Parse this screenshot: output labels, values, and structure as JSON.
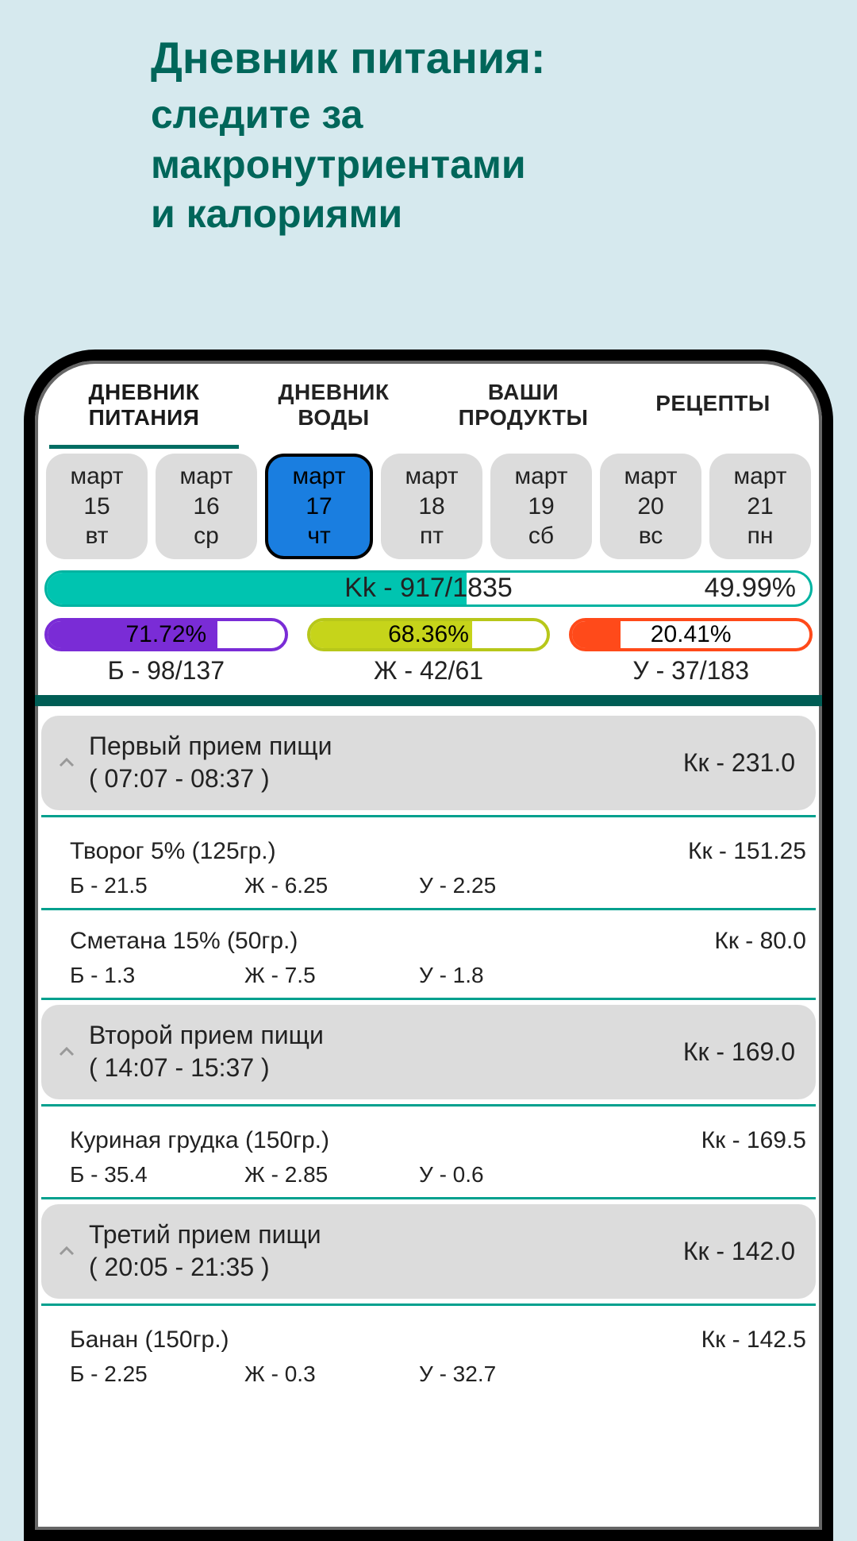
{
  "promo": {
    "title": "Дневник питания:",
    "subtitle": "следите за\nмакронутриентами\nи калориями"
  },
  "tabs": [
    {
      "label": "ДНЕВНИК\nПИТАНИЯ",
      "active": true
    },
    {
      "label": "ДНЕВНИК\nВОДЫ",
      "active": false
    },
    {
      "label": "ВАШИ\nПРОДУКТЫ",
      "active": false
    },
    {
      "label": "РЕЦЕПТЫ",
      "active": false
    }
  ],
  "dates": [
    {
      "month": "март",
      "day": "15",
      "weekday": "вт"
    },
    {
      "month": "март",
      "day": "16",
      "weekday": "ср"
    },
    {
      "month": "март",
      "day": "17",
      "weekday": "чт",
      "selected": true
    },
    {
      "month": "март",
      "day": "18",
      "weekday": "пт"
    },
    {
      "month": "март",
      "day": "19",
      "weekday": "сб"
    },
    {
      "month": "март",
      "day": "20",
      "weekday": "вс"
    },
    {
      "month": "март",
      "day": "21",
      "weekday": "пн"
    }
  ],
  "kk": {
    "center": "Kk - 917/1835",
    "percent": "49.99%",
    "fillPct": 55
  },
  "macros": {
    "b": {
      "pct": "71.72%",
      "fill": 71.72,
      "label": "Б - 98/137"
    },
    "f": {
      "pct": "68.36%",
      "fill": 68.36,
      "label": "Ж - 42/61"
    },
    "u": {
      "pct": "20.41%",
      "fill": 20.41,
      "label": "У - 37/183"
    }
  },
  "meals": [
    {
      "title": "Первый прием пищи",
      "time": "( 07:07 - 08:37 )",
      "kk": "Кк - 231.0",
      "items": [
        {
          "name": "Творог 5% (125гр.)",
          "kk": "Кк - 151.25",
          "b": "Б - 21.5",
          "f": "Ж - 6.25",
          "u": "У - 2.25"
        },
        {
          "name": "Сметана 15% (50гр.)",
          "kk": "Кк - 80.0",
          "b": "Б - 1.3",
          "f": "Ж - 7.5",
          "u": "У - 1.8"
        }
      ]
    },
    {
      "title": "Второй прием пищи",
      "time": "( 14:07 - 15:37 )",
      "kk": "Кк - 169.0",
      "items": [
        {
          "name": "Куриная грудка (150гр.)",
          "kk": "Кк - 169.5",
          "b": "Б - 35.4",
          "f": "Ж - 2.85",
          "u": "У - 0.6"
        }
      ]
    },
    {
      "title": "Третий прием пищи",
      "time": "( 20:05 - 21:35 )",
      "kk": "Кк - 142.0",
      "items": [
        {
          "name": "Банан (150гр.)",
          "kk": "Кк - 142.5",
          "b": "Б - 2.25",
          "f": "Ж - 0.3",
          "u": "У - 32.7"
        }
      ]
    }
  ]
}
